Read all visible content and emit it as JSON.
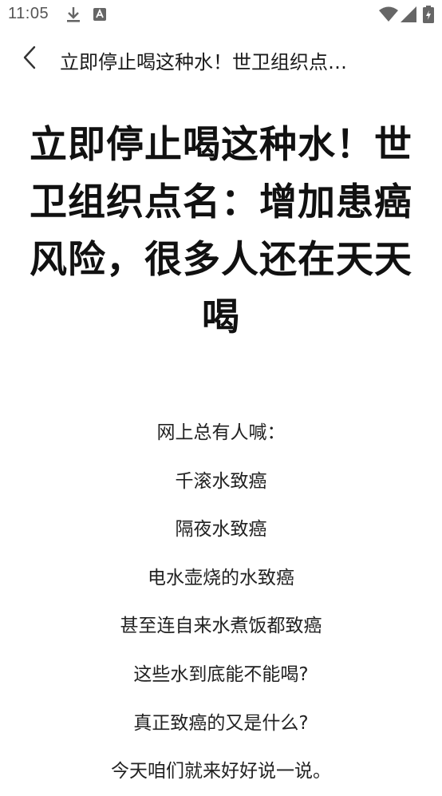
{
  "status_bar": {
    "time": "11:05",
    "icons": [
      "download-icon",
      "app-notification-icon",
      "wifi-icon",
      "signal-icon",
      "battery-icon"
    ]
  },
  "nav": {
    "title": "立即停止喝这种水！世卫组织点…"
  },
  "article": {
    "title": "立即停止喝这种水！世卫组织点名：增加患癌风险，很多人还在天天喝",
    "paragraphs": [
      "网上总有人喊：",
      "千滚水致癌",
      "隔夜水致癌",
      "电水壶烧的水致癌",
      "甚至连自来水煮饭都致癌",
      "这些水到底能不能喝?",
      "真正致癌的又是什么?",
      "今天咱们就来好好说一说。"
    ]
  }
}
